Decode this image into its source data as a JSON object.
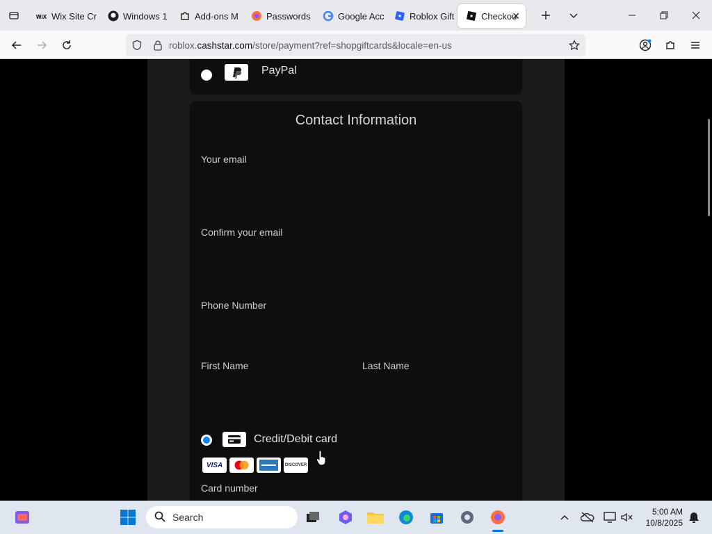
{
  "browser": {
    "tabs": [
      {
        "title": "Wix Site Cr",
        "favicon": "wix-icon"
      },
      {
        "title": "Windows 1",
        "favicon": "github-icon"
      },
      {
        "title": "Add-ons M",
        "favicon": "puzzle-icon"
      },
      {
        "title": "Passwords",
        "favicon": "firefox-icon"
      },
      {
        "title": "Google Acc",
        "favicon": "google-icon"
      },
      {
        "title": "Roblox Gift",
        "favicon": "roblox-icon"
      },
      {
        "title": "Checkou",
        "favicon": "roblox-checkout-icon",
        "active": true
      }
    ],
    "url": {
      "prefix": "roblox.",
      "host": "cashstar.com",
      "path": "/store/payment?ref=shopgiftcards&locale=en-us"
    }
  },
  "page": {
    "paypal_label": "PayPal",
    "contact": {
      "heading": "Contact Information",
      "email_label": "Your email",
      "confirm_email_label": "Confirm your email",
      "phone_label": "Phone Number",
      "first_name_label": "First Name",
      "last_name_label": "Last Name"
    },
    "card_option": {
      "label": "Credit/Debit card",
      "selected": true,
      "brands": [
        "VISA",
        "Mastercard",
        "AMEX",
        "DISCOVER"
      ]
    },
    "card_number_label": "Card number"
  },
  "taskbar": {
    "search_placeholder": "Search",
    "time": "5:00 AM",
    "date": "10/8/2025"
  },
  "colors": {
    "accent_blue": "#0a84ff",
    "page_bg": "#000000",
    "column_bg": "#1a1a1b",
    "card_bg": "#0e0e0f",
    "label_text": "#cfcfd2"
  }
}
